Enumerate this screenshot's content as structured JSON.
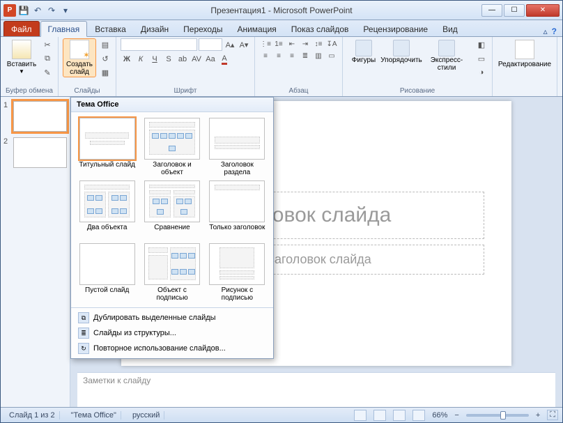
{
  "titlebar": {
    "app_title": "Презентация1 - Microsoft PowerPoint"
  },
  "tabs": {
    "file": "Файл",
    "items": [
      "Главная",
      "Вставка",
      "Дизайн",
      "Переходы",
      "Анимация",
      "Показ слайдов",
      "Рецензирование",
      "Вид"
    ],
    "active_index": 0
  },
  "ribbon": {
    "clipboard": {
      "paste": "Вставить",
      "label": "Буфер обмена"
    },
    "slides": {
      "new": "Создать\nслайд",
      "label": "Слайды"
    },
    "font": {
      "label": "Шрифт"
    },
    "para": {
      "label": "Абзац"
    },
    "draw": {
      "shapes": "Фигуры",
      "arrange": "Упорядочить",
      "styles": "Экспресс-стили",
      "label": "Рисование"
    },
    "edit": {
      "label": "Редактирование"
    }
  },
  "gallery": {
    "header": "Тема Office",
    "layouts": [
      "Титульный слайд",
      "Заголовок и объект",
      "Заголовок раздела",
      "Два объекта",
      "Сравнение",
      "Только заголовок",
      "Пустой слайд",
      "Объект с подписью",
      "Рисунок с подписью"
    ],
    "footer": [
      "Дублировать выделенные слайды",
      "Слайды из структуры...",
      "Повторное использование слайдов..."
    ]
  },
  "thumbs": {
    "items": [
      1,
      2
    ],
    "selected": 0
  },
  "slide": {
    "title_ph": "головок слайда",
    "sub_ph": "дзаголовок слайда"
  },
  "notes": {
    "placeholder": "Заметки к слайду"
  },
  "status": {
    "slide": "Слайд 1 из 2",
    "theme": "\"Тема Office\"",
    "lang": "русский",
    "zoom": "66%"
  }
}
